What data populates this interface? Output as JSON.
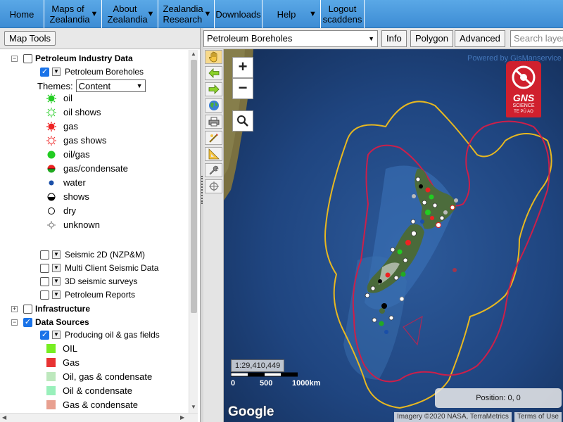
{
  "nav": {
    "items": [
      {
        "label": "Home",
        "has_dropdown": false
      },
      {
        "label": "Maps of Zealandia",
        "has_dropdown": true
      },
      {
        "label": "About Zealandia",
        "has_dropdown": true
      },
      {
        "label": "Zealandia Research",
        "has_dropdown": true
      },
      {
        "label": "Downloads",
        "has_dropdown": false
      },
      {
        "label": "Help",
        "has_dropdown": true
      },
      {
        "label": "Logout scaddens",
        "has_dropdown": false
      }
    ]
  },
  "left_panel": {
    "map_tools_label": "Map Tools",
    "groups": {
      "petroleum": {
        "label": "Petroleum Industry Data",
        "expanded": true,
        "checked": false
      },
      "infrastructure": {
        "label": "Infrastructure",
        "expanded": false,
        "checked": false
      },
      "data_sources": {
        "label": "Data Sources",
        "expanded": true,
        "checked": true
      }
    },
    "boreholes": {
      "label": "Petroleum Boreholes",
      "checked": true,
      "themes_label": "Themes:",
      "theme_value": "Content"
    },
    "legend": [
      {
        "label": "oil",
        "icon": "oil-icon",
        "color": "#22cc22"
      },
      {
        "label": "oil shows",
        "icon": "oil-shows-icon",
        "color": "#22cc22"
      },
      {
        "label": "gas",
        "icon": "gas-icon",
        "color": "#ee2222"
      },
      {
        "label": "gas shows",
        "icon": "gas-shows-icon",
        "color": "#ee2222"
      },
      {
        "label": "oil/gas",
        "icon": "oil-gas-icon",
        "color": "#22cc22"
      },
      {
        "label": "gas/condensate",
        "icon": "gas-condensate-icon",
        "color": "#ee2222"
      },
      {
        "label": "water",
        "icon": "water-icon",
        "color": "#1a4fa8"
      },
      {
        "label": "shows",
        "icon": "shows-icon",
        "color": "#000000"
      },
      {
        "label": "dry",
        "icon": "dry-icon",
        "color": "#000000"
      },
      {
        "label": "unknown",
        "icon": "unknown-icon",
        "color": "#777777"
      }
    ],
    "layers": [
      {
        "label": "Seismic 2D (NZP&M)",
        "checked": false
      },
      {
        "label": "Multi Client Seismic Data",
        "checked": false
      },
      {
        "label": "3D seismic surveys",
        "checked": false
      },
      {
        "label": "Petroleum Reports",
        "checked": false
      }
    ],
    "producing": {
      "label": "Producing oil & gas fields",
      "checked": true
    },
    "field_legend": [
      {
        "label": "OIL",
        "color": "#77ee22"
      },
      {
        "label": "Gas",
        "color": "#e83333"
      },
      {
        "label": "Oil, gas & condensate",
        "color": "#bde8bd"
      },
      {
        "label": "Oil & condensate",
        "color": "#99f0bb"
      },
      {
        "label": "Gas & condensate",
        "color": "#e8a090"
      }
    ]
  },
  "map_toolbar": {
    "layer_select": "Petroleum Boreholes",
    "info_button": "Info",
    "polygon_button": "Polygon",
    "advanced_button": "Advanced",
    "search_placeholder": "Search layers"
  },
  "map": {
    "zoom_in": "+",
    "zoom_out": "−",
    "scale_ratio": "1:29,410,449",
    "scale_labels": [
      "0",
      "500",
      "1000km"
    ],
    "position": "Position: 0, 0",
    "powered_by": "Powered by GisManservice",
    "logo_text": "GNS",
    "logo_sub": "SCIENCE",
    "logo_sub2": "TE PŪ AO",
    "google_logo": "Google",
    "imagery_credit": "Imagery ©2020 NASA, TerraMetrics",
    "terms": "Terms of Use"
  }
}
